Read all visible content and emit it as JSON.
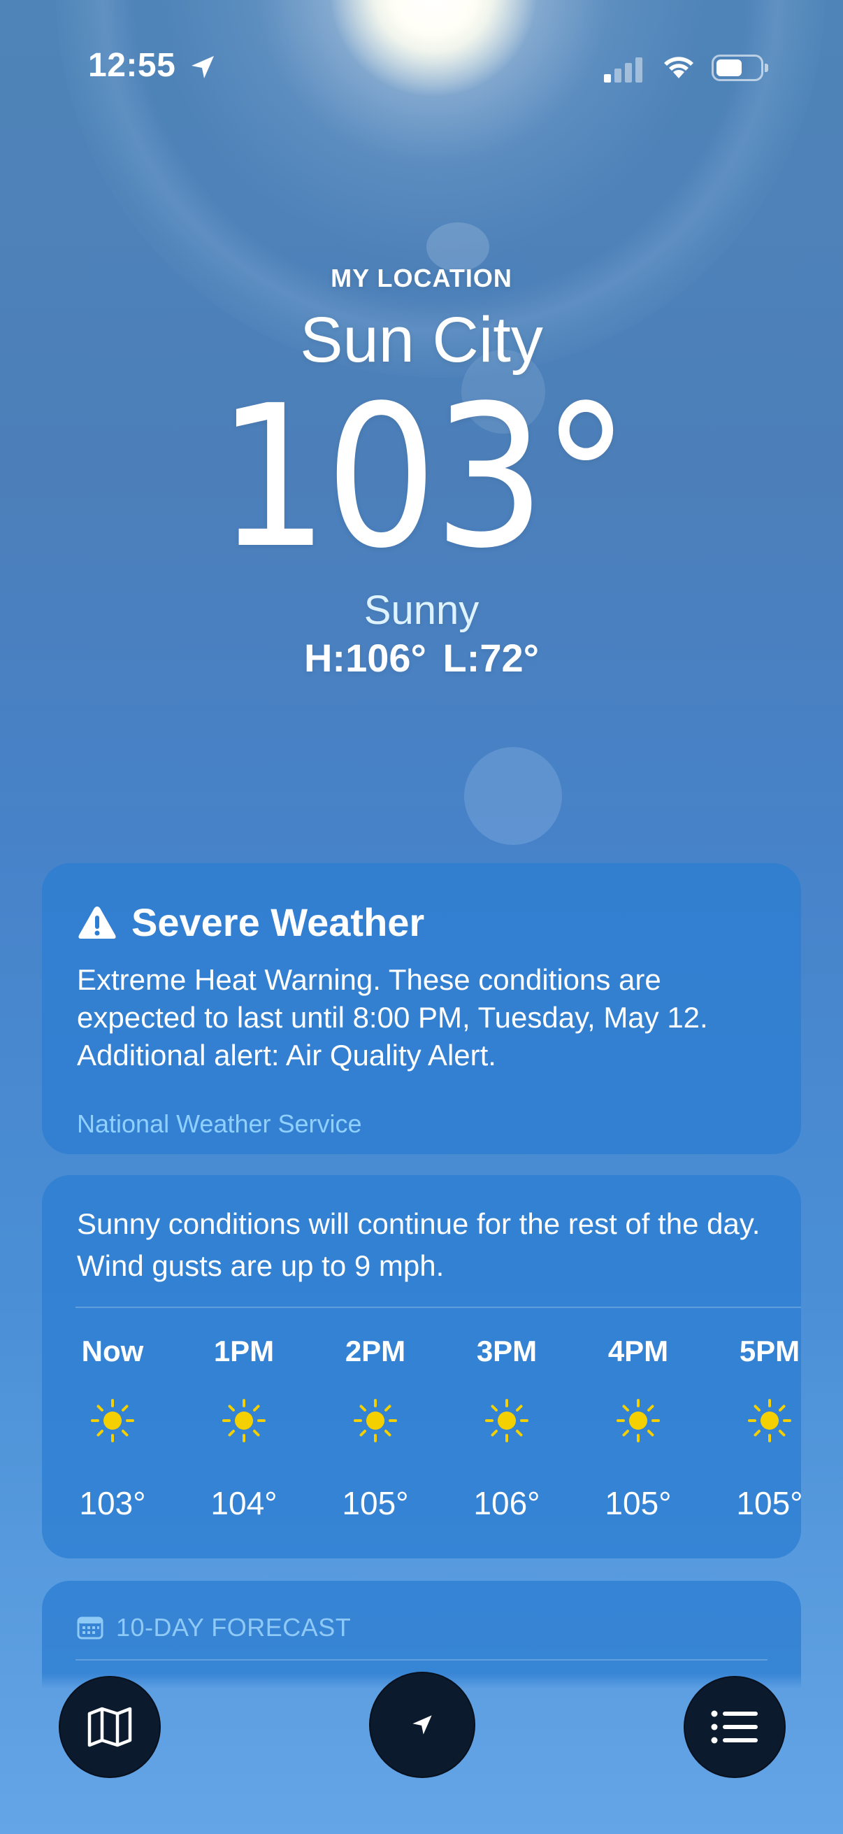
{
  "status_bar": {
    "time": "12:55",
    "location_icon": "location-arrow-icon",
    "signal_icon": "cellular-signal-icon",
    "wifi_icon": "wifi-icon",
    "battery_icon": "battery-icon"
  },
  "header": {
    "location_label": "MY LOCATION",
    "city": "Sun City",
    "temperature": "103°",
    "condition": "Sunny",
    "high_low": "H:106°  L:72°"
  },
  "alert": {
    "icon": "warning-triangle-icon",
    "title": "Severe Weather",
    "body": "Extreme Heat Warning. These conditions are expected to last until 8:00 PM, Tuesday, May 12. Additional alert: Air Quality Alert.",
    "source": "National Weather Service"
  },
  "hourly": {
    "summary": "Sunny conditions will continue for the rest of the day. Wind gusts are up to 9 mph.",
    "hours": [
      {
        "label": "Now",
        "icon": "sun-icon",
        "temp": "103°"
      },
      {
        "label": "1PM",
        "icon": "sun-icon",
        "temp": "104°"
      },
      {
        "label": "2PM",
        "icon": "sun-icon",
        "temp": "105°"
      },
      {
        "label": "3PM",
        "icon": "sun-icon",
        "temp": "106°"
      },
      {
        "label": "4PM",
        "icon": "sun-icon",
        "temp": "105°"
      },
      {
        "label": "5PM",
        "icon": "sun-icon",
        "temp": "105°"
      }
    ]
  },
  "forecast": {
    "icon": "calendar-icon",
    "title": "10-DAY FORECAST"
  },
  "toolbar": {
    "map_icon": "map-icon",
    "location_icon": "location-arrow-icon",
    "list_icon": "list-icon"
  },
  "colors": {
    "sun_icon": "#f5d000",
    "alert_source": "#8fd0ff",
    "card_bg": "#2d7dd2",
    "toolbar_button": "#0b1a2c"
  }
}
